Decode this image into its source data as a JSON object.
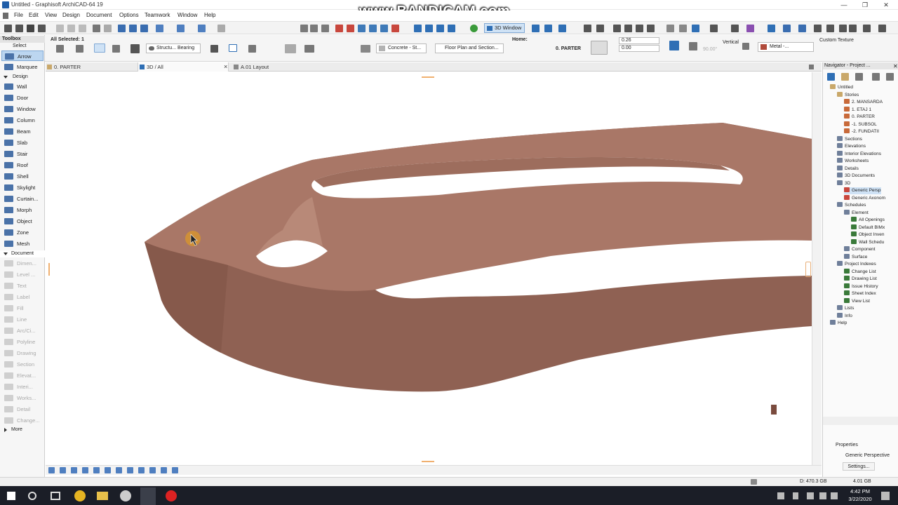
{
  "window": {
    "title": "Untitled - Graphisoft ArchiCAD-64 19",
    "controls": [
      "—",
      "❐",
      "✕"
    ]
  },
  "watermark": "www.BANDICAM.com",
  "menu": [
    "File",
    "Edit",
    "View",
    "Design",
    "Document",
    "Options",
    "Teamwork",
    "Window",
    "Help"
  ],
  "toolbar": {
    "view_3d_label": "3D Window"
  },
  "infobox": {
    "all_selected": "All Selected: 1",
    "structure_label": "Structu... Bearing",
    "material_label": "Concrete - St...",
    "floorplan_label": "Floor Plan and Section...",
    "home_label": "Home:",
    "story_value": "0. PARTER",
    "value_top": "0.26",
    "value_bottom": "0.00",
    "vertical_label": "Vertical",
    "angle_value": "90.00°",
    "surface_label": "Metal -...",
    "texture_label": "Custom Texture"
  },
  "toolbox": {
    "title": "Toolbox",
    "select_header": "Select",
    "select_tools": [
      {
        "label": "Arrow"
      },
      {
        "label": "Marquee"
      }
    ],
    "design_header": "Design",
    "design_tools": [
      {
        "label": "Wall"
      },
      {
        "label": "Door"
      },
      {
        "label": "Window"
      },
      {
        "label": "Column"
      },
      {
        "label": "Beam"
      },
      {
        "label": "Slab"
      },
      {
        "label": "Stair"
      },
      {
        "label": "Roof"
      },
      {
        "label": "Shell"
      },
      {
        "label": "Skylight"
      },
      {
        "label": "Curtain..."
      },
      {
        "label": "Morph"
      },
      {
        "label": "Object"
      },
      {
        "label": "Zone"
      },
      {
        "label": "Mesh"
      }
    ],
    "document_header": "Document",
    "document_tools": [
      {
        "label": "Dimen..."
      },
      {
        "label": "Level ..."
      },
      {
        "label": "Text"
      },
      {
        "label": "Label"
      },
      {
        "label": "Fill"
      },
      {
        "label": "Line"
      },
      {
        "label": "Arc/Ci..."
      },
      {
        "label": "Polyline"
      },
      {
        "label": "Drawing"
      },
      {
        "label": "Section"
      },
      {
        "label": "Elevat..."
      },
      {
        "label": "Interi..."
      },
      {
        "label": "Works..."
      },
      {
        "label": "Detail"
      },
      {
        "label": "Change..."
      }
    ],
    "more_label": "More"
  },
  "tabs": [
    {
      "label": "0. PARTER"
    },
    {
      "label": "3D / All"
    },
    {
      "label": "A.01 Layout"
    }
  ],
  "tab_close": "×",
  "navigator": {
    "title": "Navigator - Project ...",
    "items": [
      {
        "label": "Untitled",
        "kind": "folder"
      },
      {
        "label": "Stories",
        "kind": "folder"
      },
      {
        "label": "2. MANSARDA",
        "kind": "story"
      },
      {
        "label": "1. ETAJ 1",
        "kind": "story"
      },
      {
        "label": "0. PARTER",
        "kind": "story"
      },
      {
        "label": "-1. SUBSOL",
        "kind": "story"
      },
      {
        "label": "-2. FUNDATII",
        "kind": "story"
      },
      {
        "label": "Sections",
        "kind": "view"
      },
      {
        "label": "Elevations",
        "kind": "view"
      },
      {
        "label": "Interior Elevations",
        "kind": "view"
      },
      {
        "label": "Worksheets",
        "kind": "view"
      },
      {
        "label": "Details",
        "kind": "view"
      },
      {
        "label": "3D Documents",
        "kind": "view"
      },
      {
        "label": "3D",
        "kind": "view"
      },
      {
        "label": "Generic Persp",
        "kind": "camera"
      },
      {
        "label": "Generic Axonom",
        "kind": "camera"
      },
      {
        "label": "Schedules",
        "kind": "view"
      },
      {
        "label": "Element",
        "kind": "view"
      },
      {
        "label": "All Openings",
        "kind": "list"
      },
      {
        "label": "Default BIMx",
        "kind": "list"
      },
      {
        "label": "Object Inven",
        "kind": "list"
      },
      {
        "label": "Wall Schedu",
        "kind": "list"
      },
      {
        "label": "Component",
        "kind": "view"
      },
      {
        "label": "Surface",
        "kind": "view"
      },
      {
        "label": "Project Indexes",
        "kind": "view"
      },
      {
        "label": "Change List",
        "kind": "list"
      },
      {
        "label": "Drawing List",
        "kind": "list"
      },
      {
        "label": "Issue History",
        "kind": "list"
      },
      {
        "label": "Sheet Index",
        "kind": "list"
      },
      {
        "label": "View List",
        "kind": "list"
      },
      {
        "label": "Lists",
        "kind": "view"
      },
      {
        "label": "Info",
        "kind": "view"
      },
      {
        "label": "Help",
        "kind": "view"
      }
    ],
    "properties_title": "Properties",
    "properties_value": "Generic Perspective",
    "settings_label": "Settings..."
  },
  "status": {
    "disk": "D: 470.3 GB",
    "memory": "4.01 GB"
  },
  "taskbar": {
    "time": "4:42 PM",
    "date": "3/22/2020"
  },
  "colors": {
    "model_fill": "#9e6e5e",
    "model_side": "#8c5f51",
    "model_top": "#ad7b6a",
    "accent": "#1f5da8"
  }
}
